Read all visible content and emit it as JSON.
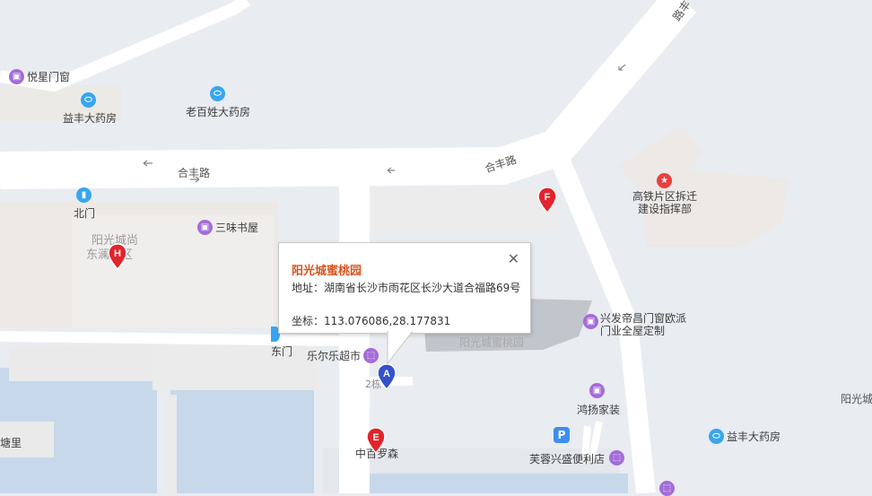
{
  "map": {
    "roads": {
      "hefeng_west": "合丰路",
      "hefeng_east": "合丰路",
      "road_ne": "路丰"
    },
    "areas": {
      "compound_line1": "阳光城尚",
      "compound_line2": "东澜园区",
      "faded_name": "阳光城蜜桃园",
      "right_edge": "阳光城"
    },
    "pois": [
      {
        "id": "yuexing",
        "label": "悦星门窗",
        "icon": "shop-bag-icon"
      },
      {
        "id": "yifeng1",
        "label": "益丰大药房",
        "icon": "pill-icon"
      },
      {
        "id": "laobaixing",
        "label": "老百姓大药房",
        "icon": "pill-icon"
      },
      {
        "id": "beimen",
        "label": "北门",
        "icon": "door-icon"
      },
      {
        "id": "sanwei",
        "label": "三味书屋",
        "icon": "shop-bag-icon"
      },
      {
        "id": "dongmen",
        "label": "东门",
        "icon": "door-icon"
      },
      {
        "id": "leerle",
        "label": "乐尔乐超市",
        "icon": "cart-icon"
      },
      {
        "id": "building2",
        "label": "2栋",
        "icon": ""
      },
      {
        "id": "tangli",
        "label": "塘里",
        "icon": ""
      },
      {
        "id": "zhongbai",
        "label": "中百罗森",
        "icon": ""
      },
      {
        "id": "gaotie_line1",
        "label": "高铁片区拆迁",
        "icon": "star-icon"
      },
      {
        "id": "gaotie_line2",
        "label": "建设指挥部",
        "icon": ""
      },
      {
        "id": "xingfa_line1",
        "label": "兴发帝昌门窗欧派",
        "icon": "shop-bag-icon"
      },
      {
        "id": "xingfa_line2",
        "label": "门业全屋定制",
        "icon": ""
      },
      {
        "id": "hongyang",
        "label": "鸿扬家装",
        "icon": "shop-bag-icon"
      },
      {
        "id": "furong",
        "label": "芙蓉兴盛便利店",
        "icon": "cart-icon"
      },
      {
        "id": "yifeng2",
        "label": "益丰大药房",
        "icon": "pill-icon"
      }
    ],
    "markers": [
      {
        "letter": "A",
        "color": "#3352cc"
      },
      {
        "letter": "E",
        "color": "#e2242c"
      },
      {
        "letter": "F",
        "color": "#e2242c"
      },
      {
        "letter": "H",
        "color": "#e2242c"
      }
    ],
    "parking_symbol": "P"
  },
  "popup": {
    "title": "阳光城蜜桃园",
    "address_label": "地址：",
    "address": "湖南省长沙市雨花区长沙大道合福路69号",
    "coord_label": "坐标：",
    "coord": "113.076086,28.177831",
    "close_symbol": "✕"
  }
}
